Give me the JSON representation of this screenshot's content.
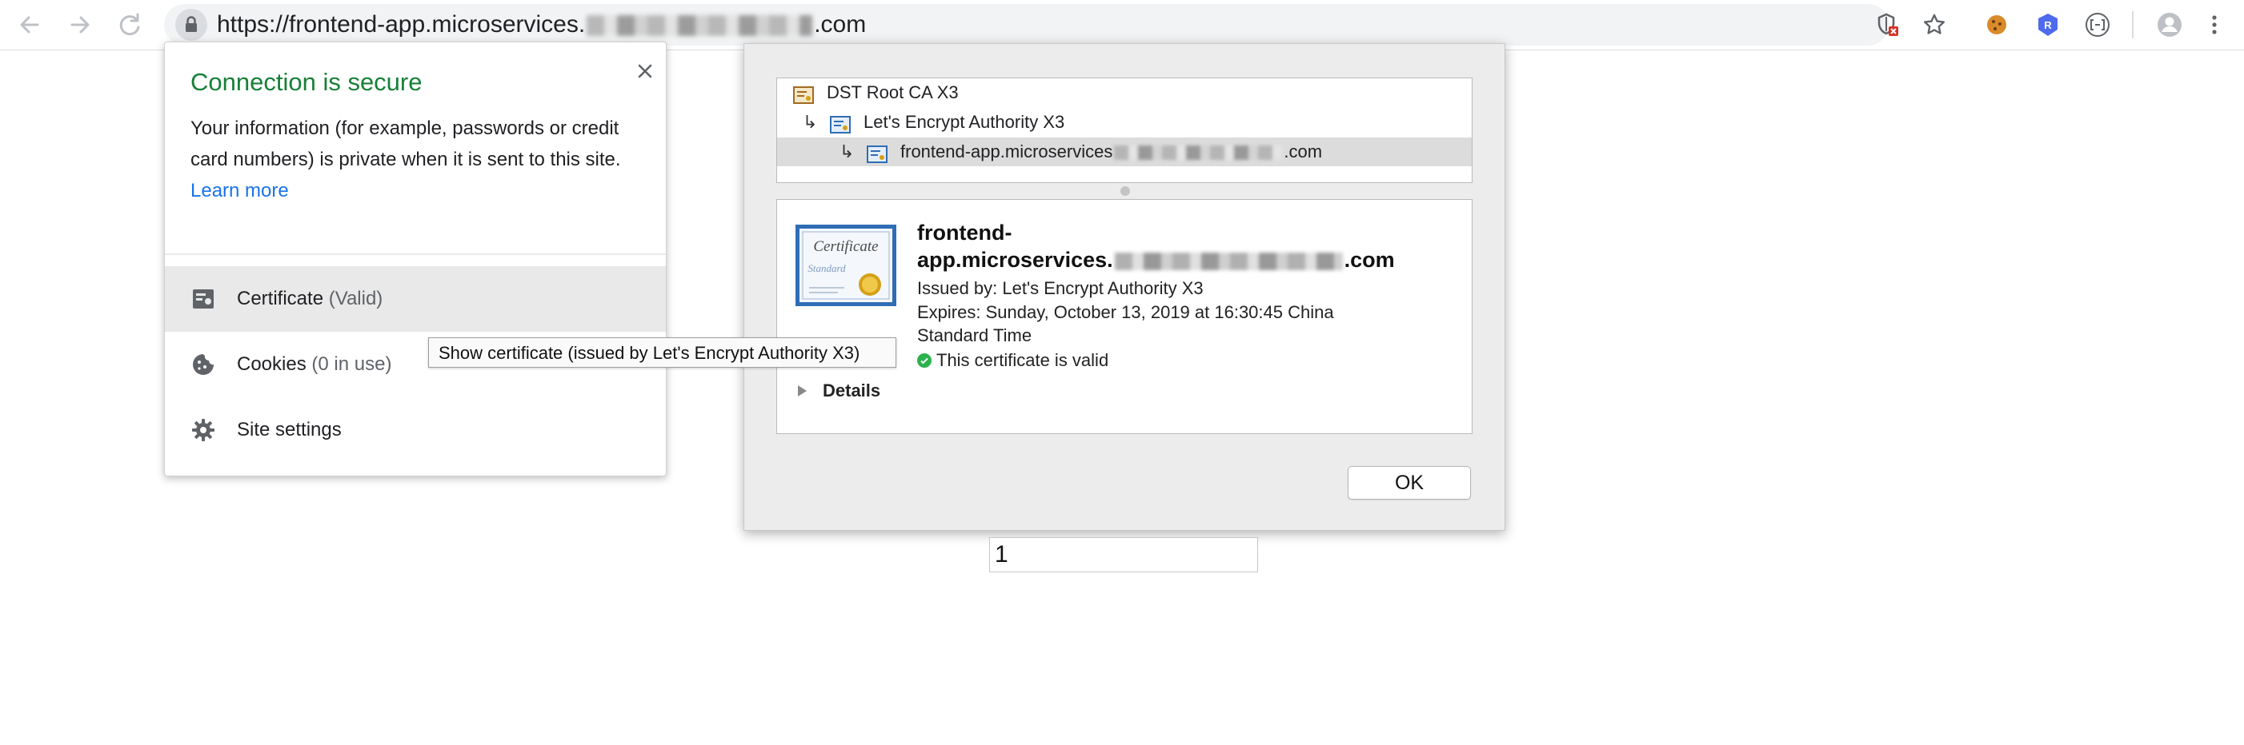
{
  "browser": {
    "url_prefix": "https://frontend-app.microservices.",
    "url_suffix": ".com",
    "icons": [
      "back-arrow-icon",
      "forward-arrow-icon",
      "reload-icon",
      "lock-icon",
      "shield-blocked-icon",
      "star-icon",
      "cookie-extension-icon",
      "r-extension-icon",
      "bracket-extension-icon",
      "profile-avatar-icon",
      "more-vert-icon"
    ]
  },
  "site_info": {
    "title": "Connection is secure",
    "description": "Your information (for example, passwords or credit card numbers) is private when it is sent to this site.",
    "learn_more": "Learn more",
    "rows": [
      {
        "label": "Certificate",
        "detail": "(Valid)",
        "icon": "certificate-icon"
      },
      {
        "label": "Cookies",
        "detail": "(0 in use)",
        "icon": "cookie-icon"
      },
      {
        "label": "Site settings",
        "detail": "",
        "icon": "gear-icon"
      }
    ]
  },
  "tooltip": "Show certificate (issued by Let's Encrypt Authority X3)",
  "certificate": {
    "chain": [
      {
        "name": "DST Root CA X3"
      },
      {
        "name": "Let's Encrypt Authority X3"
      },
      {
        "name_prefix": "frontend-app.microservices",
        "name_suffix": ".com"
      }
    ],
    "name_line1": "frontend-",
    "name_line2_prefix": "app.microservices.",
    "name_line2_suffix": ".com",
    "issued_by": "Issued by: Let's Encrypt Authority X3",
    "expires_line1": "Expires: Sunday, October 13, 2019 at 16:30:45 China",
    "expires_line2": "Standard Time",
    "valid_text": "This certificate is valid",
    "details_label": "Details",
    "ok_label": "OK"
  },
  "page": {
    "input_value": "1"
  },
  "colors": {
    "secure_green": "#188038",
    "link_blue": "#1a73e8",
    "valid_green": "#2bb24c"
  }
}
